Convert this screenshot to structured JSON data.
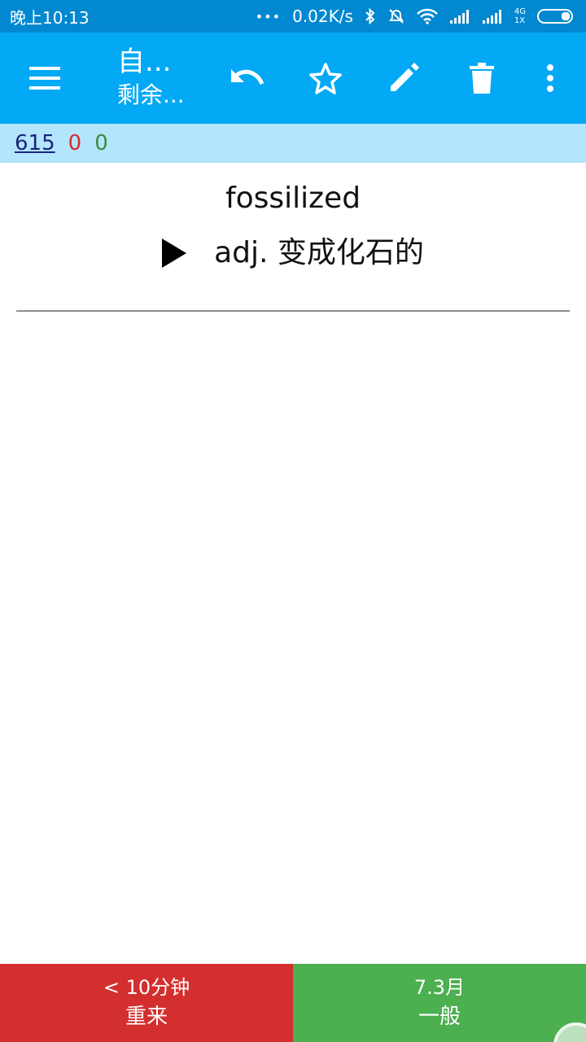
{
  "status_bar": {
    "time": "晚上10:13",
    "dots": "•••",
    "speed": "0.02K/s",
    "net_top": "4G",
    "net_bottom": "1X"
  },
  "toolbar": {
    "title": "自...",
    "subtitle": "剩余...",
    "icons": {
      "menu": "menu-icon",
      "undo": "undo-icon",
      "star": "star-outline-icon",
      "edit": "pencil-icon",
      "delete": "trash-icon",
      "more": "more-vert-icon"
    }
  },
  "counts": {
    "total": "615",
    "red": "0",
    "green": "0"
  },
  "card": {
    "word": "fossilized",
    "definition": "adj. 变成化石的"
  },
  "answers": {
    "again": {
      "interval": "< 10分钟",
      "label": "重来",
      "color": "#d32f2f"
    },
    "good": {
      "interval": "7.3月",
      "label": "一般",
      "color": "#4caf50"
    }
  },
  "colors": {
    "status_bar": "#0288d1",
    "toolbar": "#03a9f4",
    "counts_bar": "#b3e5fc"
  }
}
